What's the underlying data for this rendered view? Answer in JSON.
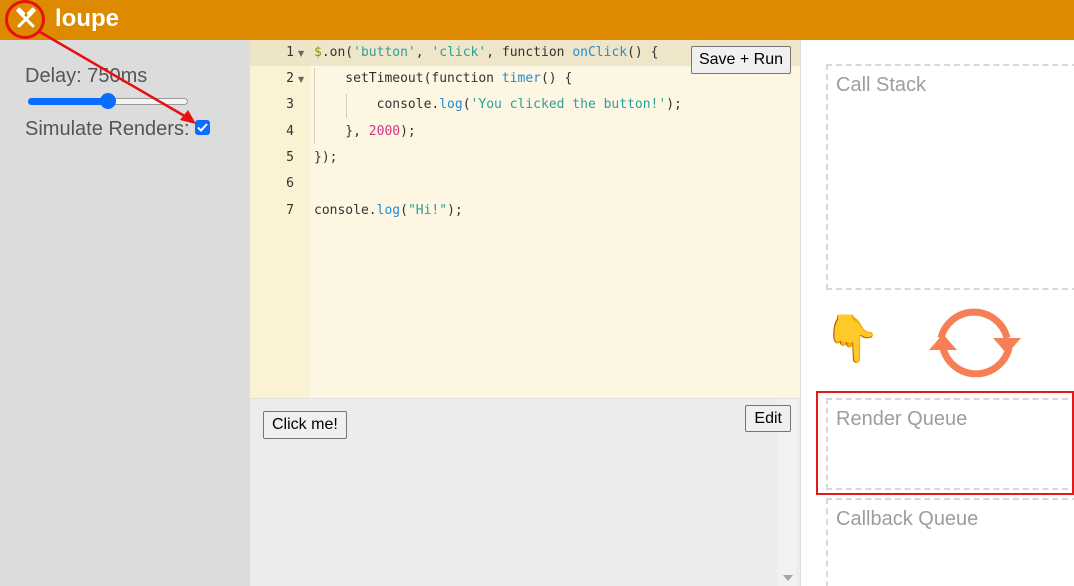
{
  "header": {
    "app_title": "loupe",
    "logo_icon": "crossed-hammers-icon",
    "background": "#de8a00"
  },
  "sidebar": {
    "delay_label": "Delay: 750ms",
    "delay_level": 0.5,
    "simulate_label": "Simulate Renders:",
    "simulate_checked": true
  },
  "editor": {
    "save_run_label": "Save + Run",
    "line_numbers": [
      "1",
      "2",
      "3",
      "4",
      "5",
      "6",
      "7"
    ],
    "code": [
      "$.on('button', 'click', function onClick() {",
      "    setTimeout(function timer() {",
      "        console.log('You clicked the button!');",
      "    }, 2000);",
      "});",
      "",
      "console.log(\"Hi!\");"
    ]
  },
  "preview": {
    "click_me_label": "Click me!",
    "edit_label": "Edit"
  },
  "panels": {
    "call_stack": "Call Stack",
    "render_queue": "Render Queue",
    "callback_queue": "Callback Queue",
    "hand_icon": "pointing-down-hand-icon",
    "loop_icon": "event-loop-icon"
  },
  "colors": {
    "accent": "#de8a00",
    "checkbox": "#0b6cff",
    "annotation": "#e61010",
    "loop": "#f77f55"
  }
}
